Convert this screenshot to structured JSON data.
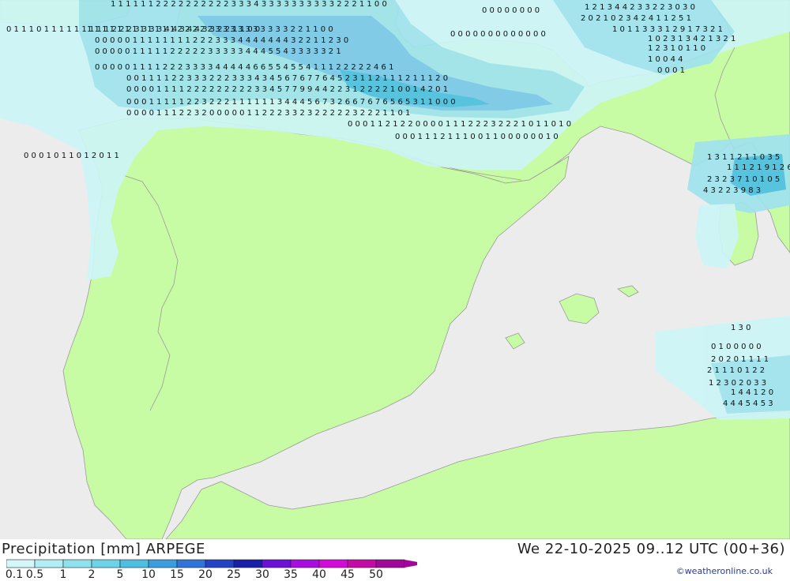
{
  "header": {
    "product": "Precipitation [mm] ARPEGE",
    "valid_time": "We 22-10-2025 09..12 UTC (00+36)",
    "credit": "©weatheronline.co.uk"
  },
  "legend": {
    "labels": [
      "0.1",
      "0.5",
      "1",
      "2",
      "5",
      "10",
      "15",
      "20",
      "25",
      "30",
      "35",
      "40",
      "45",
      "50"
    ],
    "colors": [
      "#d4f7f9",
      "#b0eef4",
      "#8ee2ee",
      "#6dd3e8",
      "#4fbfe1",
      "#3a9de0",
      "#2f74d9",
      "#2243c4",
      "#1820a8",
      "#6a12d8",
      "#a80ee0",
      "#d30bd8",
      "#c40ba6",
      "#a0089a"
    ]
  },
  "map": {
    "colors": {
      "sea": "#ececec",
      "land": "#c8fca4",
      "border": "#9a9a9a",
      "light_precip": "#cdf5f7",
      "mid_precip": "#9fe3ee",
      "heavy_precip": "#7cc7ec"
    },
    "value_rows": [
      {
        "text": "1 1 1 1 1 1 2 2 2 2 2 2 2 2 2 2 3 3 3 4 3 3 3 3 3 3 3 3 3 3 2 2 2 1 1 0 0"
      },
      {
        "text": "1 1 1 1 1 1 1 1 1 1 1 1 2 2 2 2 2 3 3 3 3 3 3 3 3 3 3 2 2 1 1 0 0"
      },
      {
        "text": "0 1 1 1 0 1 1 1 1 1 1 1 1 1 2 2 2 3 3 3 3 4 4 3 4 4 3 3 2 2 1 1 0 0"
      },
      {
        "text": "0 0 0 0 0 1 1 1 1 1 1 1 1 2 2 2 3 3 3 4 4 4 4 4 4 4 3 2 2 1 1 2 3 0"
      },
      {
        "text": "0 0 0 0 0 1 1 1 1 1 2 2 2 2 2 3 3 3 3 3 4 4 4 5 5 4 3 3 3 3 3 2 1"
      },
      {
        "text": "0 0 0 0 0 1 1 1 1 2 2 2 3 3 3 3 4 4 4 4 4 6 6 5 5 4 5 5 4 1 1 1 2 2 2 2 2 4 6 1"
      },
      {
        "text": "0 0 1 1 1 1 2 2 3 3 3 2 2 2 3 3 3 4 3 4 5 6 7 6 7 7 6 4 5 2 3 1 1 2 1 1 1 2 1 1 1 2 0"
      },
      {
        "text": "0 0 0 0 1 1 1 1 2 2 2 2 2 2 2 2 2 3 3 4 5 7 7 9 9 4 4 2 2 3 1 2 2 2 2 1 0 0 1 4 2 0 1"
      },
      {
        "text": "0 0 0 1 1 1 1 1 2 2 3 2 2 2 1 1 1 1 1 1 3 4 4 4 5 6 7 3 2 6 6 7 6 7 6 5 6 5 3 1 1 0 0 0"
      },
      {
        "text": "0 0 0 0 1 1 1 2 2 3 2 0 0 0 0 0 1 1 2 2 2 3 3 2 3 2 2 2 2 2 3 2 2 2 1 1 0 1"
      },
      {
        "text": "0 0 0 1 1 2 1 2 2 0 0 0 0 1 1 1 2 2 2 3 2 2 2 1 0 1 1 0 1 0"
      },
      {
        "text": "0 0 0 1 1 1 2 1 1 1 0 0 1 1 0 0 0 0 0 0 1 0"
      },
      {
        "text": "1 3 1 1 2 1 1 0 3 5"
      },
      {
        "text": "1 1 1 2 1 9 1 2 6 1"
      },
      {
        "text": "2 3 2 3 7 1 0 1 0 5"
      },
      {
        "text": "4 3 2 2 3 9 8 3"
      },
      {
        "text": "1 3 0"
      },
      {
        "text": "0 1 0 0 0 0 0"
      },
      {
        "text": "2 0 2 0 1 1 1 1"
      },
      {
        "text": "2 1 1 1 0 1 2 2"
      },
      {
        "text": "1 2 3 0 2 0 3 3"
      },
      {
        "text": "1 4 4 1 2 0"
      },
      {
        "text": "4 4 4 5 4 5 3"
      },
      {
        "text": "1 2 1 3 4 4 2 3 3 2 2 3 0 3 0"
      },
      {
        "text": "2 0 2 1 0 2 3 4 2 4 1 1 2 5 1"
      },
      {
        "text": "1 0 1 1 3 3 3 1 2 9 1 7 3 2 1"
      },
      {
        "text": "1 0 2 3 1 3 4 2 1 3 2 1"
      },
      {
        "text": "1 2 3 1 0 1 1 0"
      },
      {
        "text": "1 0 0 4 4"
      },
      {
        "text": "0 0 0 1"
      },
      {
        "text": "0 0 0 0 0 0 0 0"
      },
      {
        "text": "0 0 0 0 0 0 0 0 0 0 0 0 0"
      },
      {
        "text": "0 0 0 1 0 1 1 0 1 2 0 1 1"
      }
    ]
  }
}
